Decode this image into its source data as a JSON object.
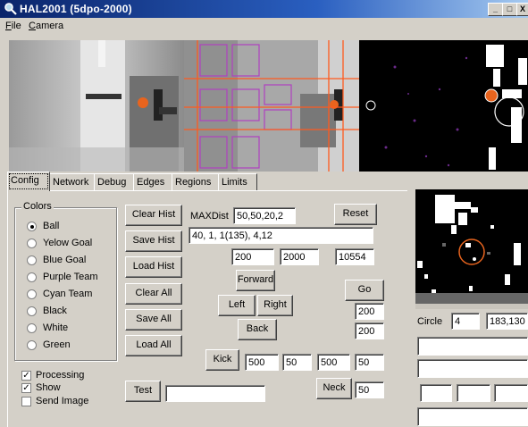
{
  "window": {
    "title": "HAL2001  (5dpo-2000)",
    "min": "_",
    "max": "□",
    "close": "X"
  },
  "menu": [
    {
      "label": "File",
      "ul": "F",
      "rest": "ile"
    },
    {
      "label": "Camera",
      "ul": "C",
      "rest": "amera"
    }
  ],
  "tabs": [
    {
      "label": "Config",
      "active": true
    },
    {
      "label": "Network",
      "active": false
    },
    {
      "label": "Debug",
      "active": false
    },
    {
      "label": "Edges",
      "active": false
    },
    {
      "label": "Regions",
      "active": false
    },
    {
      "label": "Limits",
      "active": false
    }
  ],
  "colors_group": {
    "title": "Colors",
    "options": [
      {
        "label": "Ball",
        "selected": true
      },
      {
        "label": "Yelow Goal",
        "selected": false
      },
      {
        "label": "Blue Goal",
        "selected": false
      },
      {
        "label": "Purple Team",
        "selected": false
      },
      {
        "label": "Cyan Team",
        "selected": false
      },
      {
        "label": "Black",
        "selected": false
      },
      {
        "label": "White",
        "selected": false
      },
      {
        "label": "Green",
        "selected": false
      }
    ]
  },
  "checkboxes": [
    {
      "label": "Processing",
      "checked": true
    },
    {
      "label": "Show",
      "checked": true
    },
    {
      "label": "Send Image",
      "checked": false
    }
  ],
  "buttons": {
    "clear_hist": "Clear Hist",
    "save_hist": "Save Hist",
    "load_hist": "Load Hist",
    "clear_all": "Clear All",
    "save_all": "Save All",
    "load_all": "Load All",
    "reset": "Reset",
    "forward": "Forward",
    "left": "Left",
    "right": "Right",
    "back": "Back",
    "go": "Go",
    "kick": "Kick",
    "neck": "Neck",
    "test": "Test"
  },
  "fields": {
    "maxdist_label": "MAXDist",
    "maxdist": "50,50,20,2",
    "hist_params": "40, 1, 1(135), 4,12",
    "v1": "200",
    "v2": "2000",
    "v3": "10554",
    "go_a": "200",
    "go_b": "200",
    "kick_1": "500",
    "kick_2": "50",
    "kick_3": "500",
    "kick_4": "50",
    "neck": "50",
    "test": ""
  },
  "right": {
    "circle_label": "Circle",
    "circle_value": "4",
    "circle_coords": "183,130"
  }
}
